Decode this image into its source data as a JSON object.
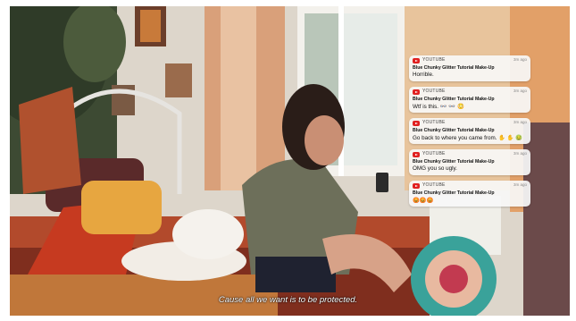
{
  "notifications": [
    {
      "app": "YOUTUBE",
      "time": "3m ago",
      "title": "Blue Chunky Glitter Tutorial Make-Up",
      "message": "Horrible."
    },
    {
      "app": "YOUTUBE",
      "time": "3m ago",
      "title": "Blue Chunky Glitter Tutorial Make-Up",
      "message": "Wtf is this. 👓 👓 😳"
    },
    {
      "app": "YOUTUBE",
      "time": "3m ago",
      "title": "Blue Chunky Glitter Tutorial Make-Up",
      "message": "Go back to where you came from. ✋ ✋ 🤢"
    },
    {
      "app": "YOUTUBE",
      "time": "3m ago",
      "title": "Blue Chunky Glitter Tutorial Make-Up",
      "message": "OMG you so ugly."
    },
    {
      "app": "YOUTUBE",
      "time": "3m ago",
      "title": "Blue Chunky Glitter Tutorial Make-Up",
      "message": "😡😡😡"
    }
  ],
  "subtitle": "Cause all we want is to be protected.",
  "colors": {
    "youtube_red": "#e02020",
    "card_bg": "#f7f7f7",
    "subtitle": "#ffffff"
  }
}
